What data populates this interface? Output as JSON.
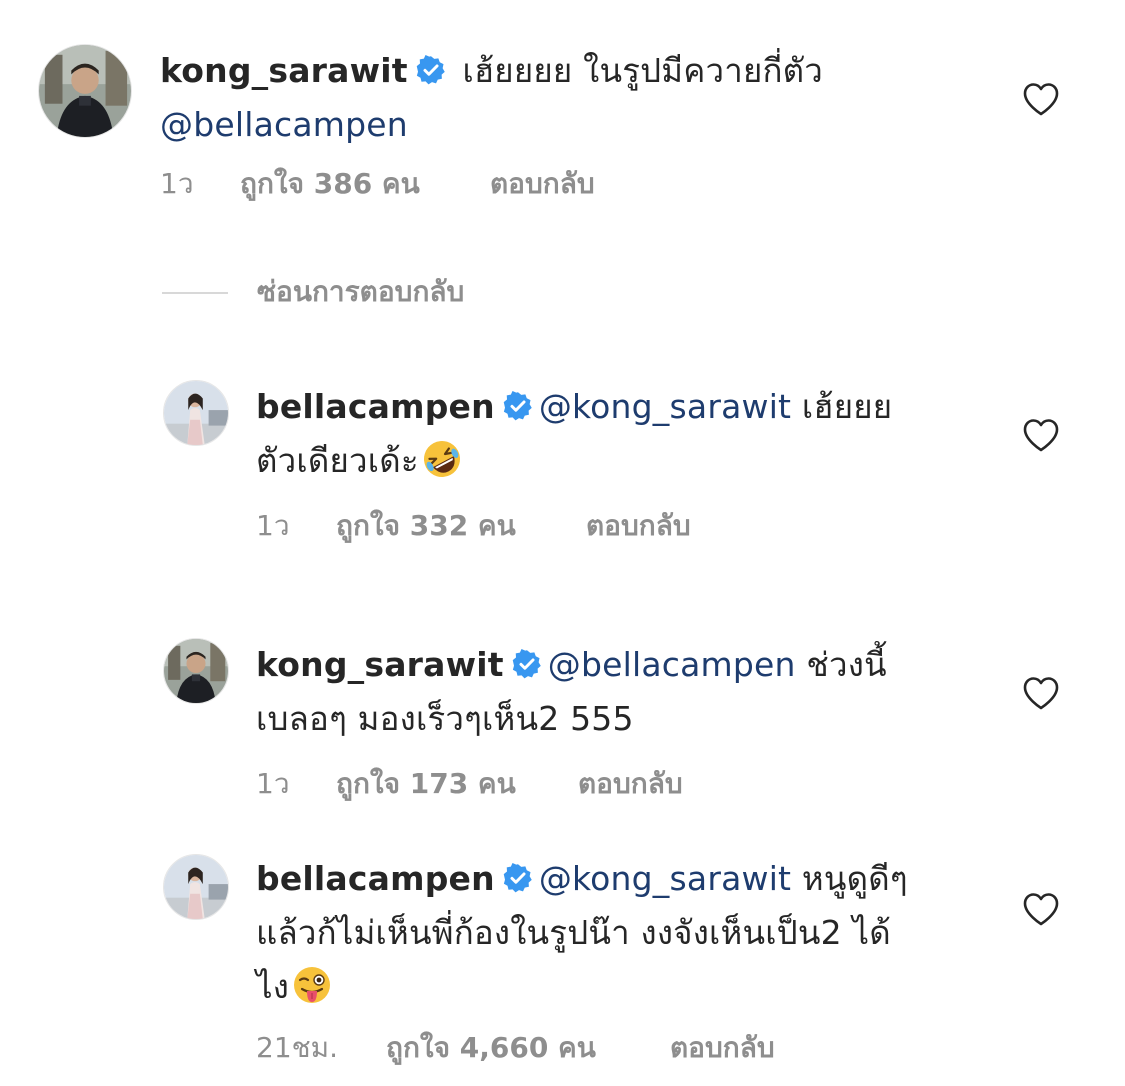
{
  "comments": [
    {
      "username": "kong_sarawit",
      "verified": true,
      "line1_text": " เฮ้ยยยย ในรูปมีควายกี่ตัว",
      "line2_mention": "@bellacampen",
      "time": "1ว",
      "likes": "ถูกใจ 386 คน",
      "reply": "ตอบกลับ"
    },
    {
      "username": "bellacampen",
      "verified": true,
      "mention": "@kong_sarawit",
      "line1_text": " เฮ้ยยย",
      "line2_text": "ตัวเดียวเด้ะ",
      "emoji": "rolling-on-floor-laughing-emoji",
      "time": "1ว",
      "likes": "ถูกใจ 332 คน",
      "reply": "ตอบกลับ"
    },
    {
      "username": "kong_sarawit",
      "verified": true,
      "mention": "@bellacampen",
      "line1_text": " ช่วงนี้",
      "line2_text": "เบลอๆ มองเร็วๆเห็น2 555",
      "time": "1ว",
      "likes": "ถูกใจ 173 คน",
      "reply": "ตอบกลับ"
    },
    {
      "username": "bellacampen",
      "verified": true,
      "mention": "@kong_sarawit",
      "line1_text": " หนูดูดีๆ",
      "line2_text": "แล้วก้ไม่เห็นพี่ก้องในรูปน๊า งงจังเห็นเป็น2 ได้",
      "line3_text": "ไง",
      "emoji": "winking-face-with-tongue-emoji",
      "time": "21ชม.",
      "likes": "ถูกใจ 4,660 คน",
      "reply": "ตอบกลับ"
    }
  ],
  "hide_replies_label": "ซ่อนการตอบกลับ",
  "colors": {
    "text": "#262626",
    "mention": "#1e3c6e",
    "meta": "#8e8e8e",
    "verified": "#3897f0",
    "divider": "#d8d8d8"
  },
  "icons": {
    "like": "heart-outline-icon",
    "verified": "verified-badge-icon"
  }
}
